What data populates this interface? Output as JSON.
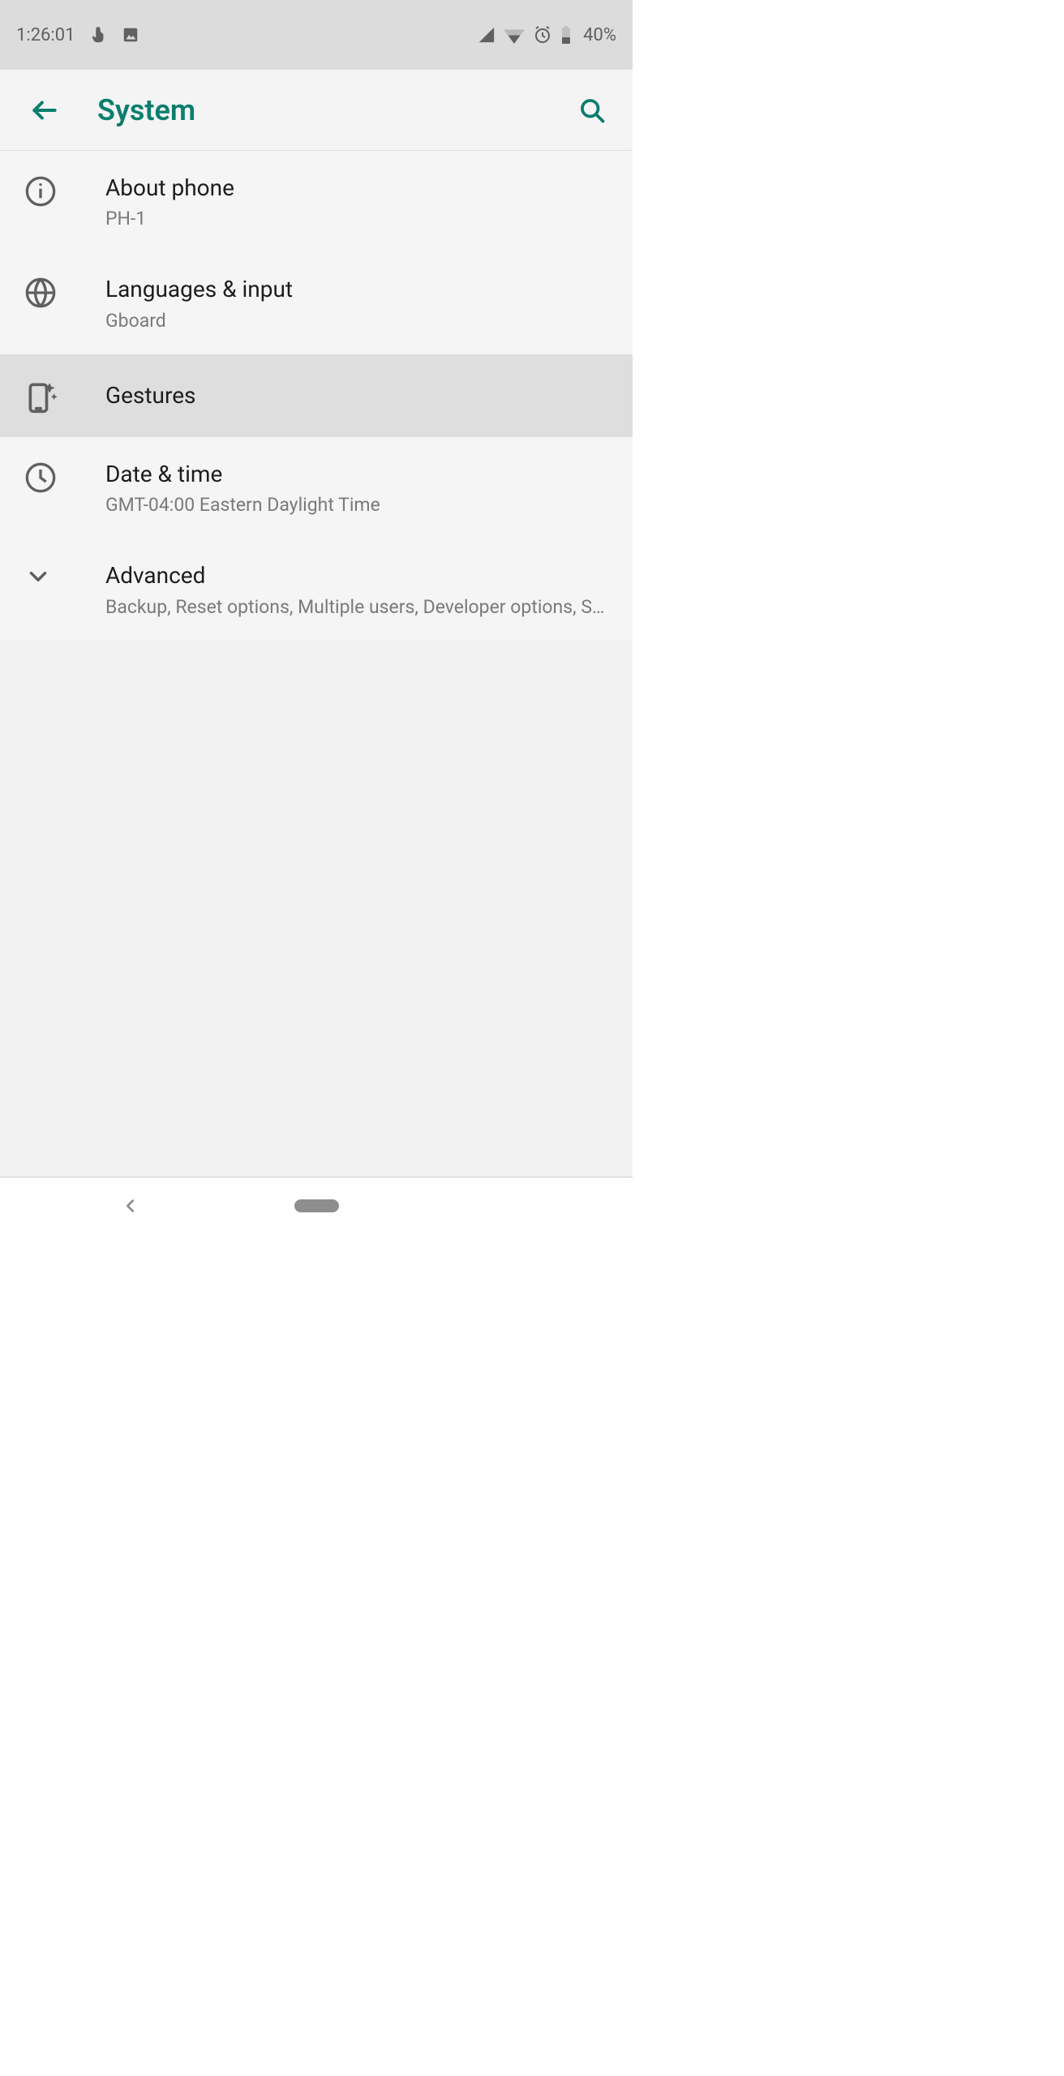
{
  "status": {
    "time": "1:26:01",
    "battery_pct": "40%"
  },
  "appbar": {
    "title": "System"
  },
  "list": [
    {
      "title": "About phone",
      "sub": "PH-1",
      "icon": "info",
      "selected": false
    },
    {
      "title": "Languages & input",
      "sub": "Gboard",
      "icon": "globe",
      "selected": false
    },
    {
      "title": "Gestures",
      "sub": "",
      "icon": "gesture-phone",
      "selected": true
    },
    {
      "title": "Date & time",
      "sub": "GMT-04:00 Eastern Daylight Time",
      "icon": "clock",
      "selected": false
    },
    {
      "title": "Advanced",
      "sub": "Backup, Reset options, Multiple users, Developer options, Syste..",
      "icon": "chevron-down",
      "selected": false
    }
  ]
}
